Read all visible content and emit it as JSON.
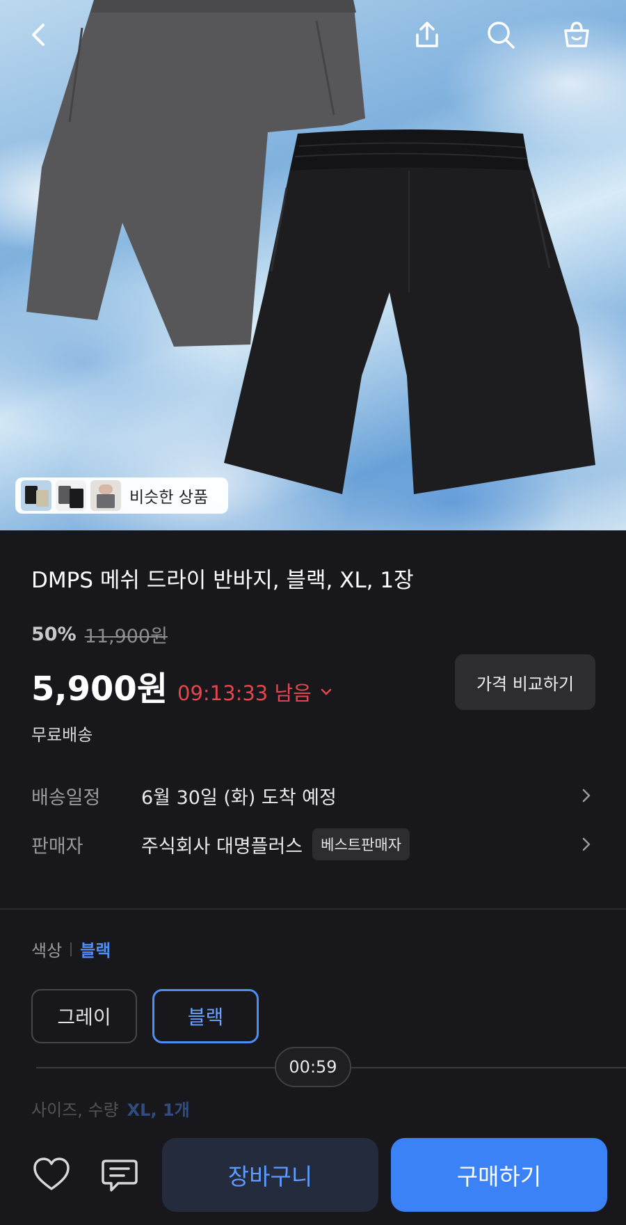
{
  "topbar": {
    "icons": [
      "back-arrow-icon",
      "share-icon",
      "search-icon",
      "shopping-bag-icon"
    ]
  },
  "hero": {
    "similar_chip_label": "비슷한 상품"
  },
  "product": {
    "title": "DMPS 메쉬 드라이 반바지, 블랙, XL, 1장",
    "discount_percent": "50%",
    "original_price": "11,900원",
    "price": "5,900원",
    "timer": "09:13:33 남음",
    "compare_button": "가격 비교하기",
    "shipping": "무료배송"
  },
  "delivery": {
    "label": "배송일정",
    "value": "6월 30일 (화) 도착 예정"
  },
  "seller": {
    "label": "판매자",
    "value": "주식회사 대명플러스",
    "badge": "베스트판매자"
  },
  "color_option": {
    "label": "색상",
    "selected": "블랙",
    "options": [
      "그레이",
      "블랙"
    ]
  },
  "video": {
    "time": "00:59"
  },
  "size_option": {
    "label": "사이즈, 수량",
    "selected": "XL, 1개"
  },
  "bottom_bar": {
    "cart_label": "장바구니",
    "buy_label": "구매하기"
  },
  "colors": {
    "background": "#18181c",
    "accent_blue": "#3b82f6",
    "timer_red": "#e6454e"
  }
}
